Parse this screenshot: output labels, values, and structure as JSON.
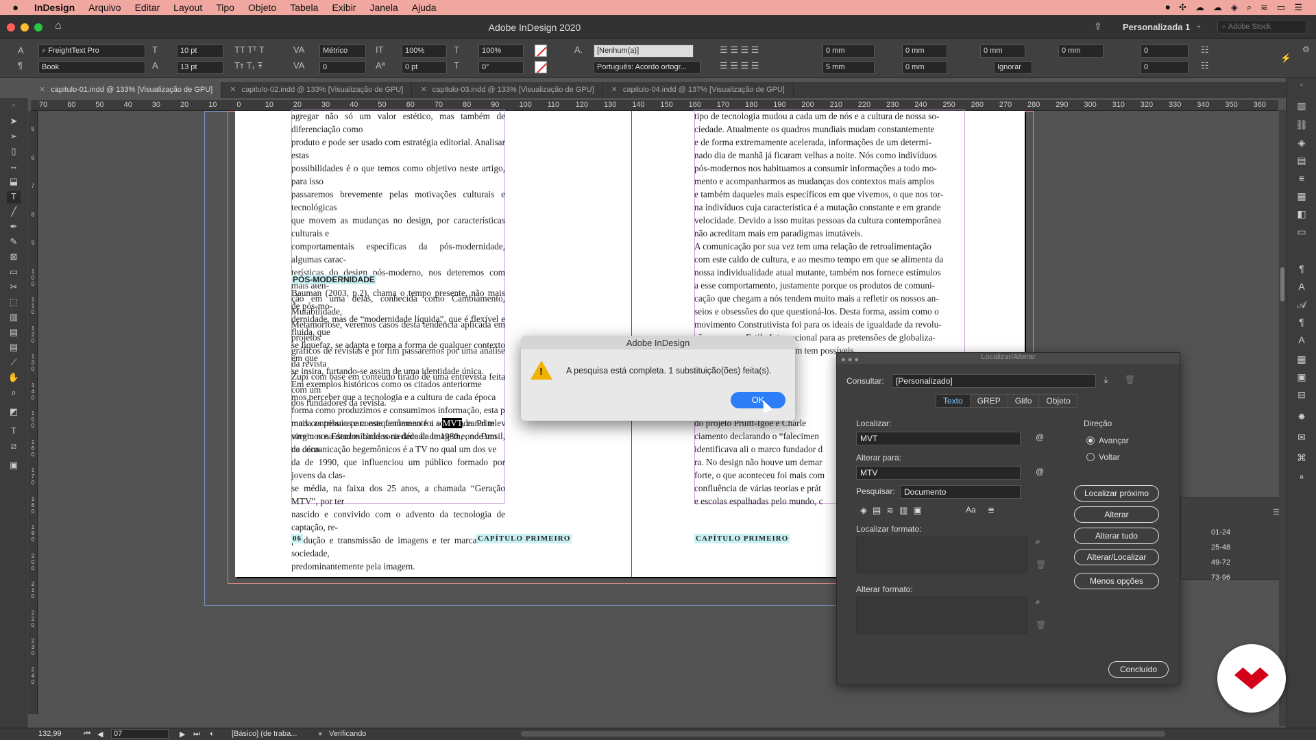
{
  "menubar": {
    "app": "InDesign",
    "items": [
      "Arquivo",
      "Editar",
      "Layout",
      "Tipo",
      "Objeto",
      "Tabela",
      "Exibir",
      "Janela",
      "Ajuda"
    ]
  },
  "window": {
    "title": "Adobe InDesign 2020",
    "workspace": "Personalizada 1",
    "stock_placeholder": "Adobe Stock"
  },
  "control": {
    "font": "FreightText Pro",
    "style": "Book",
    "size": "10 pt",
    "leading": "13 pt",
    "kerning": "Métrico",
    "tracking": "0",
    "vscale": "100%",
    "hscale": "100%",
    "baseline": "0 pt",
    "skew": "0°",
    "char_style": "[Nenhum(a)]",
    "language": "Português: Acordo ortogr...",
    "indent_left": "0 mm",
    "indent_first": "5 mm",
    "indent_right": "0 mm",
    "space_before": "0 mm",
    "space_after": "0 mm",
    "last_indent": "0 mm",
    "drop_lines": "0",
    "drop_chars": "0",
    "align_grid": "Ignorar"
  },
  "tabs": [
    {
      "label": "capitulo-01.indd @ 133% [Visualização de GPU]"
    },
    {
      "label": "capitulo-02.indd @ 133% [Visualização de GPU]"
    },
    {
      "label": "capitulo-03.indd @ 133% [Visualização de GPU]"
    },
    {
      "label": "capitulo-04.indd @ 137% [Visualização de GPU]"
    }
  ],
  "ruler_h": [
    "70",
    "60",
    "50",
    "40",
    "30",
    "20",
    "10",
    "0",
    "10",
    "20",
    "30",
    "40",
    "50",
    "60",
    "70",
    "80",
    "90",
    "100",
    "110",
    "120",
    "130",
    "140",
    "150",
    "160",
    "170",
    "180",
    "190",
    "200",
    "210",
    "220",
    "230",
    "240",
    "250",
    "260",
    "270",
    "280",
    "290",
    "300",
    "310",
    "320",
    "330",
    "340",
    "350",
    "360"
  ],
  "ruler_v": [
    "5",
    "6",
    "7",
    "8",
    "9",
    "1 0 0",
    "1 1 0",
    "1 2 0",
    "1 3 0",
    "1 4 0",
    "1 5 0",
    "1 6 0",
    "1 7 0",
    "1 8 0",
    "1 9 0",
    "2 0 0",
    "2 1 0",
    "2 2 0",
    "2 3 0",
    "2 4 0"
  ],
  "doc": {
    "left_p1": "agregar não só um valor estético, mas também de diferenciação como\nproduto e pode ser usado com estratégia editorial. Analisar estas\npossibilidades é o que temos como objetivo neste artigo, para isso\npassaremos brevemente pelas motivações culturais e tecnológicas\nque movem as mudanças no design, por características culturais e\ncomportamentais específicas da pós-modernidade, algumas carac-\nterísticas do design pós-moderno, nos deteremos com mais aten-\nção em uma delas, conhecida como Cambiamento, Mutabilidade,\nMetamorfose, veremos casos desta tendência aplicada em projetos\ngráficos de revistas e por fim passaremos por uma análise da revista\nZupi com base em conteúdo tirado de uma entrevista feita com um\ndos fundadores da revista.",
    "heading": "PÓS-MODERNIDADE",
    "left_p2": "Bauman (2003, p.2), chama o tempo presente, não mais de pós-mo-\ndernidade, mas de “modernidade líquida”, que é flexível e fluida, que\nse liquefaz, se adapta e toma a forma de qualquer contexto em que\nse insira, furtando-se assim de uma identidade única.\n    Em exemplos históricos como os citados anteriorme\nmos perceber que a tecnologia e a cultura de cada época\nforma como produzimos e consumimos informação, esta p\nmuda as pessoas e consequentemente a sociedade. Prim\nvivemos na denominada sociedade da imagem, onde um\nde comunicação hegemônicos é a TV no qual um dos ve",
    "left_p3a": "mais contribuiu para este fenômeno foi a ",
    "left_hl": "MVT",
    "left_p3b": ", canal televisivo que",
    "left_p4": "surgiu nos Estados Unidos na década de 1980 e, no Brasil, na déca-\nda de 1990, que influenciou um público formado por jovens da clas-\nse média, na faixa dos 25 anos, a chamada “Geração MTV”, por ter\nnascido e convivido com o advento da tecnologia de captação, re-\nprodução e transmissão de imagens e ter marcado essa sociedade,\npredominantemente pela imagem.",
    "right_p1": "tipo de tecnologia mudou a cada um de nós e a cultura de nossa so-\nciedade. Atualmente os quadros mundiais mudam constantemente\ne de forma extremamente acelerada, informações de um determi-\nnado dia de manhã já ficaram velhas a noite. Nós como indivíduos\npós-modernos nos habituamos a consumir informações a todo mo-\nmento e acompanharmos as mudanças dos contextos mais amplos\ne também daqueles mais específicos em que vivemos, o que nos tor-\nna indivíduos cuja característica é a mutação constante e em grande\nvelocidade. Devido a isso muitas pessoas da cultura contemporânea\nnão acreditam mais em paradigmas imutáveis.\n    A comunicação por sua vez tem uma relação de retroalimentação\ncom este caldo de cultura, e ao mesmo tempo em que se alimenta da\nnossa individualidade atual mutante, também nos fornece estímulos\na esse comportamento, justamente porque os produtos de comuni-\ncação que chegam a nós tendem muito mais a refletir os nossos an-\nseios e obsessões do que questioná-los. Desta forma, assim como o\nmovimento Construtivista foi para os ideais de igualdade da revolu-\nção russa, e o Estilo Internacional para as pretensões de globaliza-\n                                          pós-guerra, o Design também tem possíveis\n                                          desta pós-\n                                          que está n",
    "right_p2": "                                          r volta de\ndo projeto Pruitt-Igoe e Charle\nciamento declarando o “falecimen\nidentificava ali o marco fundador d\nra. No design não houve um demar\nforte, o que aconteceu foi mais com\nconfluência de várias teorias e prát\ne escolas espalhadas pelo mundo, c",
    "folio": "06",
    "chapter": "CAPÍTULO PRIMEIRO"
  },
  "alert": {
    "title": "Adobe InDesign",
    "message": "A pesquisa está completa.  1 substituição(ões) feita(s).",
    "ok": "OK"
  },
  "find": {
    "title": "Localizar/Alterar",
    "query_label": "Consultar:",
    "query_value": "[Personalizado]",
    "tabs": [
      "Texto",
      "GREP",
      "Glifo",
      "Objeto"
    ],
    "find_label": "Localizar:",
    "find_value": "MVT",
    "change_label": "Alterar para:",
    "change_value": "MTV",
    "search_label": "Pesquisar:",
    "search_value": "Documento",
    "direction_label": "Direção",
    "forward": "Avançar",
    "back": "Voltar",
    "find_format": "Localizar formato:",
    "change_format": "Alterar formato:",
    "buttons": [
      "Localizar próximo",
      "Alterar",
      "Alterar tudo",
      "Alterar/Localizar",
      "Menos opções"
    ],
    "done": "Concluído",
    "case_label": "Aa"
  },
  "pages": [
    "01-24",
    "25-48",
    "49-72",
    "73-96"
  ],
  "status": {
    "zoom": "132,99",
    "page": "07",
    "style": "[Básico] (de traba...",
    "preflight": "Verificando"
  }
}
